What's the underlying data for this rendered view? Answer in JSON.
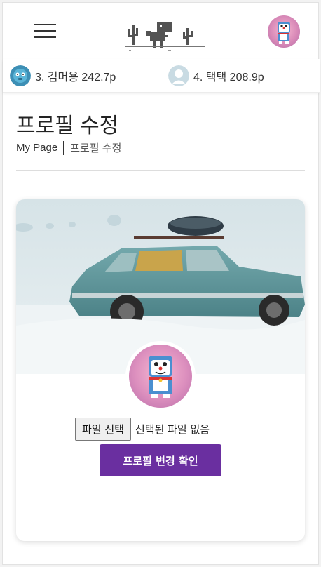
{
  "header": {
    "menu_icon": "hamburger-menu-icon",
    "logo_icon": "dinosaur-cactus-logo",
    "avatar_icon": "doraemon-avatar"
  },
  "ranking": [
    {
      "label": "3. 김머용 242.7p",
      "avatar": "blue-creature-avatar"
    },
    {
      "label": "4. 택택 208.9p",
      "avatar": "default-user-avatar"
    }
  ],
  "page": {
    "title": "프로필 수정",
    "breadcrumb": {
      "root": "My Page",
      "current": "프로필 수정"
    }
  },
  "profile_card": {
    "cover_image": "vintage-car-in-snow",
    "avatar_image": "doraemon-avatar",
    "file_button_label": "파일 선택",
    "file_status": "선택된 파일 없음",
    "submit_label": "프로필 변경 확인"
  },
  "colors": {
    "accent": "#6a2fa0",
    "avatar_bg": "#e39ac4"
  }
}
